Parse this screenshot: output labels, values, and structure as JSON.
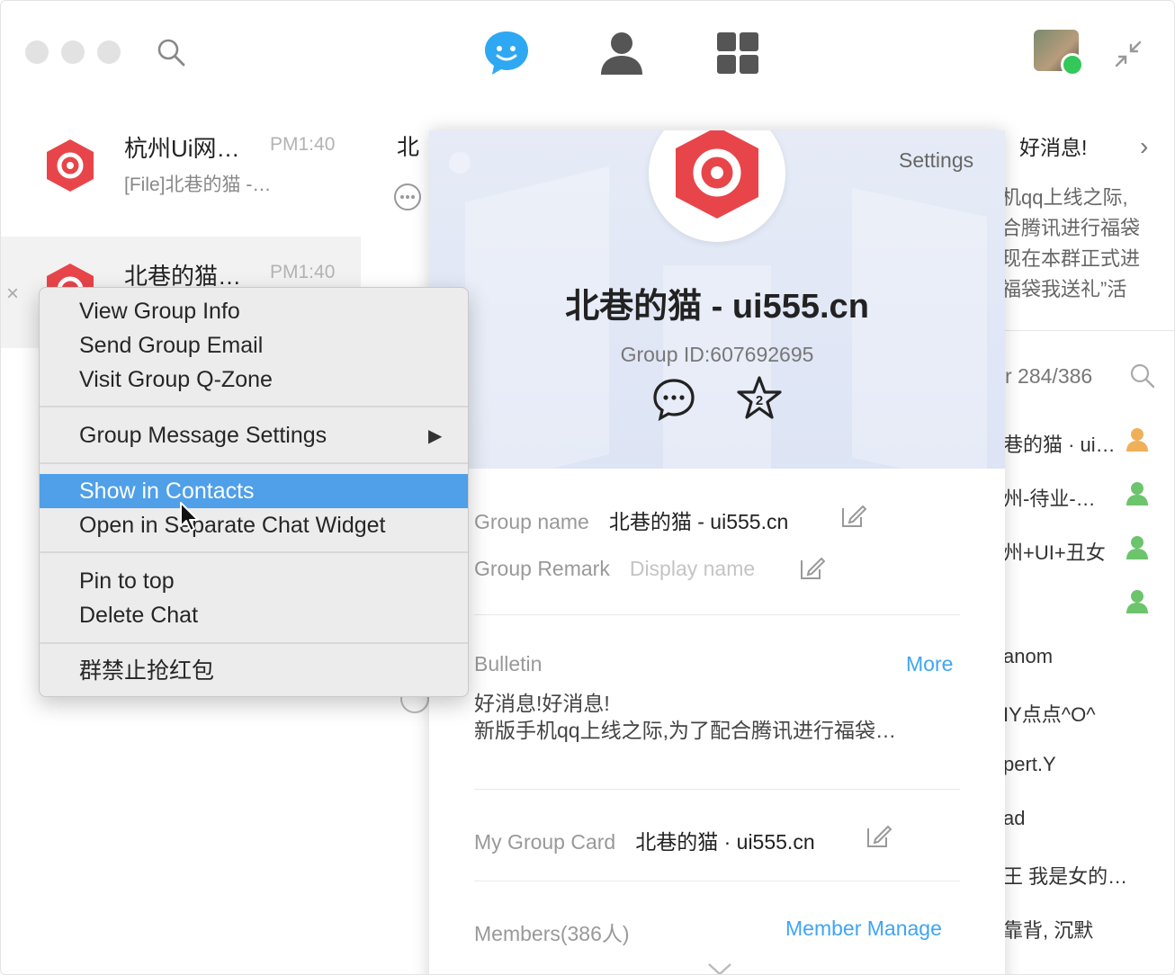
{
  "window": {
    "nav": {
      "chat_icon": "chat-bubble-icon",
      "contacts_icon": "person-icon",
      "apps_icon": "grid-icon"
    },
    "colors": {
      "accent_blue": "#3ea5f5",
      "menu_highlight": "#4f9fe9",
      "brand_red": "#e8454a",
      "online_green": "#34c759"
    }
  },
  "chat_list": [
    {
      "title": "杭州Ui网…",
      "time": "PM1:40",
      "preview": "[File]北巷的猫 -…"
    },
    {
      "title": "北巷的猫…",
      "time": "PM1:40",
      "preview": ""
    }
  ],
  "middle": {
    "title": "北"
  },
  "right_panel": {
    "header": "好消息!",
    "bulletin_lines": [
      "机qq上线之际,",
      "合腾讯进行福袋",
      "现在本群正式进",
      "福袋我送礼”活"
    ],
    "member_count": "r 284/386",
    "members": [
      {
        "name": "巷的猫 · ui…",
        "has_icon": true
      },
      {
        "name": "州-待业-…",
        "has_icon": true
      },
      {
        "name": "州+UI+丑女",
        "has_icon": true
      },
      {
        "name": "",
        "has_icon": true
      },
      {
        "name": "anom",
        "has_icon": false
      },
      {
        "name": "IY点点^O^",
        "has_icon": false
      },
      {
        "name": "pert.Y",
        "has_icon": false
      },
      {
        "name": "ad",
        "has_icon": false
      },
      {
        "name": "王  我是女的…",
        "has_icon": false
      },
      {
        "name": "靠背, 沉默",
        "has_icon": false
      }
    ]
  },
  "group_card": {
    "settings": "Settings",
    "title": "北巷的猫 - ui555.cn",
    "group_id": "Group ID:607692695",
    "group_name_label": "Group name",
    "group_name_value": "北巷的猫 - ui555.cn",
    "group_remark_label": "Group Remark",
    "group_remark_placeholder": "Display name",
    "bulletin_label": "Bulletin",
    "bulletin_more": "More",
    "bulletin_lines": [
      "好消息!好消息!",
      "新版手机qq上线之际,为了配合腾讯进行福袋…"
    ],
    "my_group_card_label": "My Group Card",
    "my_group_card_value": "北巷的猫 · ui555.cn",
    "members_label": "Members(386人)",
    "member_manage": "Member Manage"
  },
  "context_menu": {
    "items": [
      "View Group Info",
      "Send Group Email",
      "Visit Group Q-Zone",
      "Group Message Settings",
      "Show in Contacts",
      "Open in Separate Chat Widget",
      "Pin to top",
      "Delete Chat",
      "群禁止抢红包"
    ],
    "submenu_arrow": "▶",
    "highlighted_item": "Show in Contacts"
  }
}
